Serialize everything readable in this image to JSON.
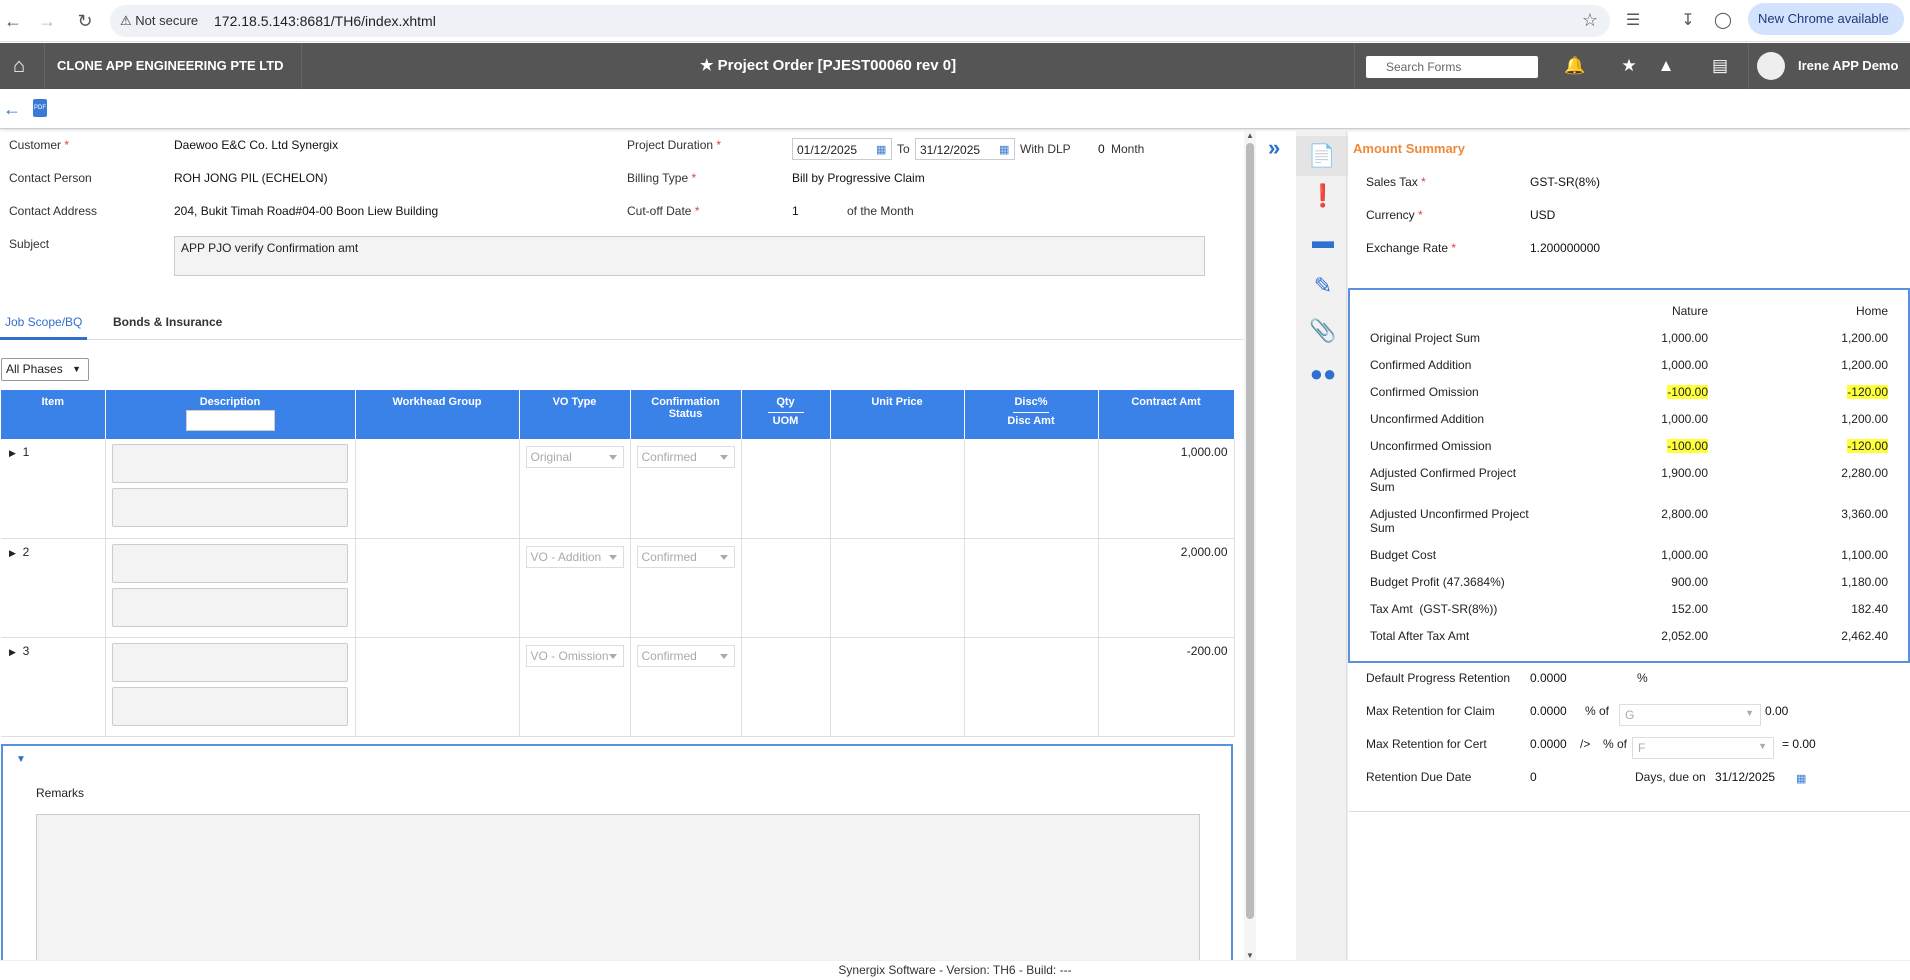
{
  "browser": {
    "not_secure": "Not secure",
    "url": "172.18.5.143:8681/TH6/index.xhtml",
    "update_label": "New Chrome available"
  },
  "app": {
    "company": "CLONE APP ENGINEERING PTE LTD",
    "title": "Project Order [PJEST00060 rev 0]",
    "search_placeholder": "Search Forms",
    "user": "Irene APP Demo"
  },
  "form": {
    "customer_label": "Customer",
    "customer": "Daewoo E&C Co. Ltd Synergix",
    "contact_person_label": "Contact Person",
    "contact_person": "ROH JONG PIL (ECHELON)",
    "contact_address_label": "Contact Address",
    "contact_address": "204, Bukit Timah Road#04-00 Boon Liew Building",
    "subject_label": "Subject",
    "subject": "APP PJO verify Confirmation amt",
    "duration_label": "Project Duration",
    "start_date": "01/12/2025",
    "to_label": "To",
    "end_date": "31/12/2025",
    "with_dlp_label": "With DLP",
    "dlp_value": "0",
    "month_label": "Month",
    "billing_type_label": "Billing Type",
    "billing_type": "Bill by Progressive Claim",
    "cutoff_label": "Cut-off Date",
    "cutoff_value": "1",
    "of_month_label": "of the Month"
  },
  "tabs": [
    {
      "label": "Job Scope/BQ"
    },
    {
      "label": "Bonds & Insurance"
    }
  ],
  "phase_filter": "All Phases",
  "grid": {
    "headers": {
      "item": "Item",
      "description": "Description",
      "workhead": "Workhead Group",
      "vo_type": "VO Type",
      "confirmation1": "Confirmation",
      "confirmation2": "Status",
      "qty": "Qty",
      "uom": "UOM",
      "unit_price": "Unit Price",
      "disc": "Disc%",
      "disc_amt": "Disc Amt",
      "contract_amt": "Contract Amt"
    },
    "rows": [
      {
        "item": "1",
        "vo_type": "Original",
        "status": "Confirmed",
        "contract_amt": "1,000.00"
      },
      {
        "item": "2",
        "vo_type": "VO - Addition",
        "status": "Confirmed",
        "contract_amt": "2,000.00"
      },
      {
        "item": "3",
        "vo_type": "VO - Omission",
        "status": "Confirmed",
        "contract_amt": "-200.00"
      }
    ]
  },
  "remarks_label": "Remarks",
  "summary": {
    "heading": "Amount Summary",
    "sales_tax_label": "Sales Tax",
    "sales_tax": "GST-SR(8%)",
    "currency_label": "Currency",
    "currency": "USD",
    "exchange_rate_label": "Exchange Rate",
    "exchange_rate": "1.200000000",
    "col_nature": "Nature",
    "col_home": "Home",
    "rows": [
      {
        "label": "Original Project Sum",
        "nature": "1,000.00",
        "home": "1,200.00"
      },
      {
        "label": "Confirmed Addition",
        "nature": "1,000.00",
        "home": "1,200.00"
      },
      {
        "label": "Confirmed Omission",
        "nature": "-100.00",
        "home": "-120.00"
      },
      {
        "label": "Unconfirmed Addition",
        "nature": "1,000.00",
        "home": "1,200.00"
      },
      {
        "label": "Unconfirmed Omission",
        "nature": "-100.00",
        "home": "-120.00"
      },
      {
        "label": "Adjusted Confirmed Project Sum",
        "nature": "1,900.00",
        "home": "2,280.00"
      },
      {
        "label": "Adjusted Unconfirmed Project Sum",
        "nature": "2,800.00",
        "home": "3,360.00"
      },
      {
        "label": "Budget Cost",
        "nature": "1,000.00",
        "home": "1,100.00"
      },
      {
        "label": "Budget Profit (47.3684%)",
        "nature": "900.00",
        "home": "1,180.00"
      },
      {
        "label": "Tax Amt  (GST-SR(8%))",
        "nature": "152.00",
        "home": "182.40"
      },
      {
        "label": "Total After Tax Amt",
        "nature": "2,052.00",
        "home": "2,462.40"
      }
    ],
    "retention": {
      "default_label": "Default Progress Retention",
      "default_value": "0.0000",
      "pct": "%",
      "claim_label": "Max Retention for Claim",
      "claim_value": "0.0000",
      "pct_of": "% of",
      "claim_sel": "G",
      "claim_result": "0.00",
      "cert_label": "Max Retention for Cert",
      "cert_value": "0.0000",
      "cert_arrow": "/>",
      "cert_sel": "F",
      "cert_result": "= 0.00",
      "due_label": "Retention Due Date",
      "due_value": "0",
      "days_due": "Days, due on",
      "due_date": "31/12/2025"
    }
  },
  "footer": "Synergix Software - Version: TH6 - Build: ---"
}
